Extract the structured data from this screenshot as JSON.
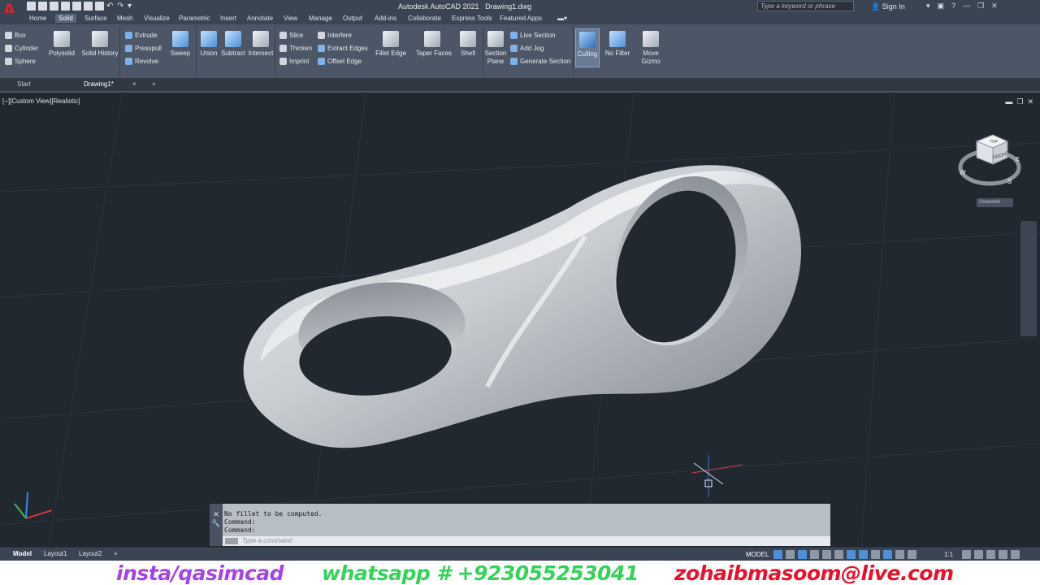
{
  "app": {
    "title": "Autodesk AutoCAD 2021",
    "filename": "Drawing1.dwg",
    "logo": "A"
  },
  "search": {
    "placeholder": "Type a keyword or phrase"
  },
  "account": {
    "signin": "Sign In"
  },
  "menu_tabs": [
    "Home",
    "Solid",
    "Surface",
    "Mesh",
    "Visualize",
    "Parametric",
    "Insert",
    "Annotate",
    "View",
    "Manage",
    "Output",
    "Add-ins",
    "Collaborate",
    "Express Tools",
    "Featured Apps"
  ],
  "active_menu_tab": "Solid",
  "ribbon": {
    "primitive": [
      "Box",
      "Cylinder",
      "Sphere"
    ],
    "polysolid": "Polysolid",
    "solid_history": "Solid History",
    "solid_create": [
      "Extrude",
      "Presspull",
      "Revolve"
    ],
    "sweep": "Sweep",
    "boolean": [
      "Union",
      "Subtract",
      "Intersect"
    ],
    "solid_edit_a": [
      "Slice",
      "Thicken",
      "Imprint"
    ],
    "solid_edit_b": [
      "Interfere",
      "Extract Edges",
      "Offset Edge"
    ],
    "fillet_edge": "Fillet Edge",
    "taper_faces": "Taper Faces",
    "shell": "Shell",
    "section_plane": [
      "Section",
      "Plane"
    ],
    "section_tools": [
      "Live Section",
      "Add Jog",
      "Generate Section"
    ],
    "culling": "Culling",
    "no_filter": "No Filter",
    "move_gizmo": [
      "Move",
      "Gizmo"
    ]
  },
  "doc_tabs": {
    "start": "Start",
    "drawing": "Drawing1*",
    "close": "×",
    "new": "+"
  },
  "viewport": {
    "label": "[−][Custom View][Realistic]",
    "viewcube": {
      "top": "TOP",
      "front": "FRONT",
      "w": "W",
      "s": "S",
      "e": "E",
      "view_name": "Unnamed"
    }
  },
  "command": {
    "history": [
      "No fillet to be computed.",
      "Command:",
      "Command:"
    ],
    "placeholder": "Type a command"
  },
  "layout_tabs": [
    "Model",
    "Layout1",
    "Layout2"
  ],
  "layout_add": "+",
  "status": {
    "mode": "MODEL",
    "scale": "1:1"
  },
  "watermark": {
    "insta": "insta/qasimcad",
    "whatsapp": "whatsapp # +923055253041",
    "email": "zohaibmasoom@live.com"
  },
  "colors": {
    "accent": "#4f8fd8",
    "logo": "#d3262e",
    "insta": "#a445e4",
    "whatsapp": "#36d35a",
    "email": "#e8112c"
  }
}
